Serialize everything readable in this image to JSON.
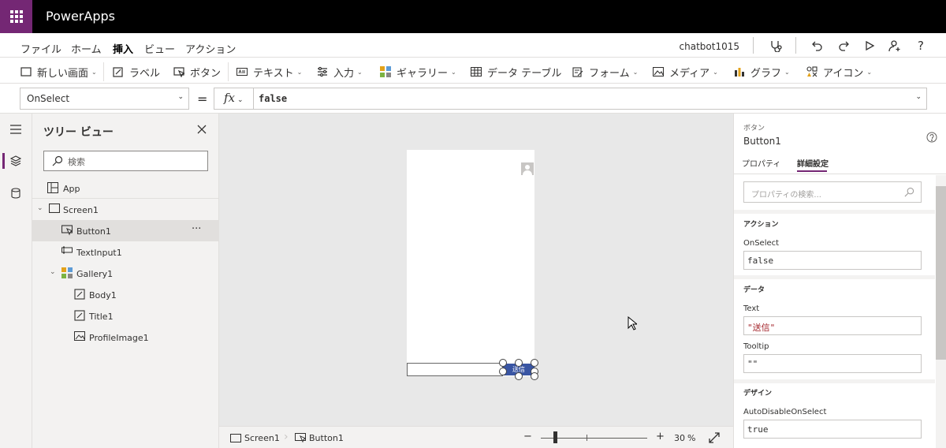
{
  "app": {
    "title": "PowerApps",
    "file_name": "chatbot1015"
  },
  "menu": {
    "items": [
      "ファイル",
      "ホーム",
      "挿入",
      "ビュー",
      "アクション"
    ],
    "active": "挿入"
  },
  "ribbon": {
    "new_screen": "新しい画面",
    "label": "ラベル",
    "button": "ボタン",
    "text": "テキスト",
    "input": "入力",
    "gallery": "ギャラリー",
    "data_table": "データ テーブル",
    "form": "フォーム",
    "media": "メディア",
    "chart": "グラフ",
    "icons": "アイコン"
  },
  "formula_bar": {
    "property": "OnSelect",
    "equals": "=",
    "fx": "fx",
    "formula": "false"
  },
  "tree": {
    "title": "ツリー ビュー",
    "search_placeholder": "検索",
    "app": "App",
    "nodes": [
      "Screen1",
      "Button1",
      "TextInput1",
      "Gallery1",
      "Body1",
      "Title1",
      "ProfileImage1"
    ],
    "more": "···"
  },
  "canvas": {
    "button_text": "送信"
  },
  "status": {
    "screen": "Screen1",
    "control": "Button1",
    "zoom": "30",
    "zoom_unit": "%",
    "zoom_minus": "−",
    "zoom_plus": "+"
  },
  "props": {
    "control_type": "ボタン",
    "control_name": "Button1",
    "tab_properties": "プロパティ",
    "tab_advanced": "詳細設定",
    "search_placeholder": "プロパティの検索...",
    "sections": {
      "action": "アクション",
      "data": "データ",
      "design": "デザイン"
    },
    "fields": {
      "onselect_label": "OnSelect",
      "onselect_value": "false",
      "text_label": "Text",
      "text_value": "\"送信\"",
      "tooltip_label": "Tooltip",
      "tooltip_value": "\"\"",
      "autodisable_label": "AutoDisableOnSelect",
      "autodisable_value": "true"
    }
  },
  "colors": {
    "brand": "#742774",
    "button": "#3955a3"
  }
}
